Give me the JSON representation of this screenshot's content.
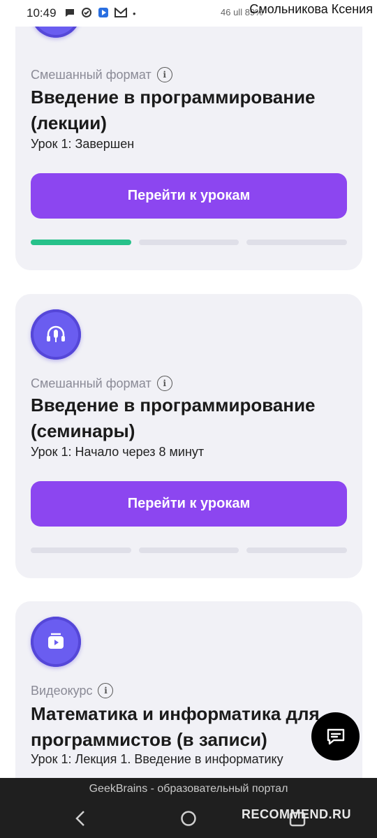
{
  "status_bar": {
    "time": "10:49",
    "right_text": "46 ull 89%"
  },
  "watermark": {
    "author": "Смольникова Ксения"
  },
  "cards": [
    {
      "icon": "video-play-icon",
      "format": "Смешанный формат",
      "title": "Введение в программирование (лекции)",
      "lesson_status": "Урок 1: Завершен",
      "button": "Перейти к урокам",
      "progress": [
        1,
        0,
        0
      ]
    },
    {
      "icon": "headphones-mic-icon",
      "format": "Смешанный формат",
      "title": "Введение в программирование (семинары)",
      "lesson_status": "Урок 1: Начало через 8 минут",
      "button": "Перейти к урокам",
      "progress": [
        0,
        0,
        0
      ]
    },
    {
      "icon": "video-icon",
      "format": "Видеокурс",
      "title": "Математика и информатика для программистов (в записи)",
      "lesson_status": "Урок 1: Лекция 1. Введение в информатику"
    }
  ],
  "browser_title": "GeekBrains - образовательный портал",
  "recommend_watermark": "RECOMMEND.RU",
  "colors": {
    "accent": "#8c46f0",
    "progress_done": "#27c18a",
    "icon_badge": "#6a5df0",
    "card_bg": "#f1f1f6"
  }
}
